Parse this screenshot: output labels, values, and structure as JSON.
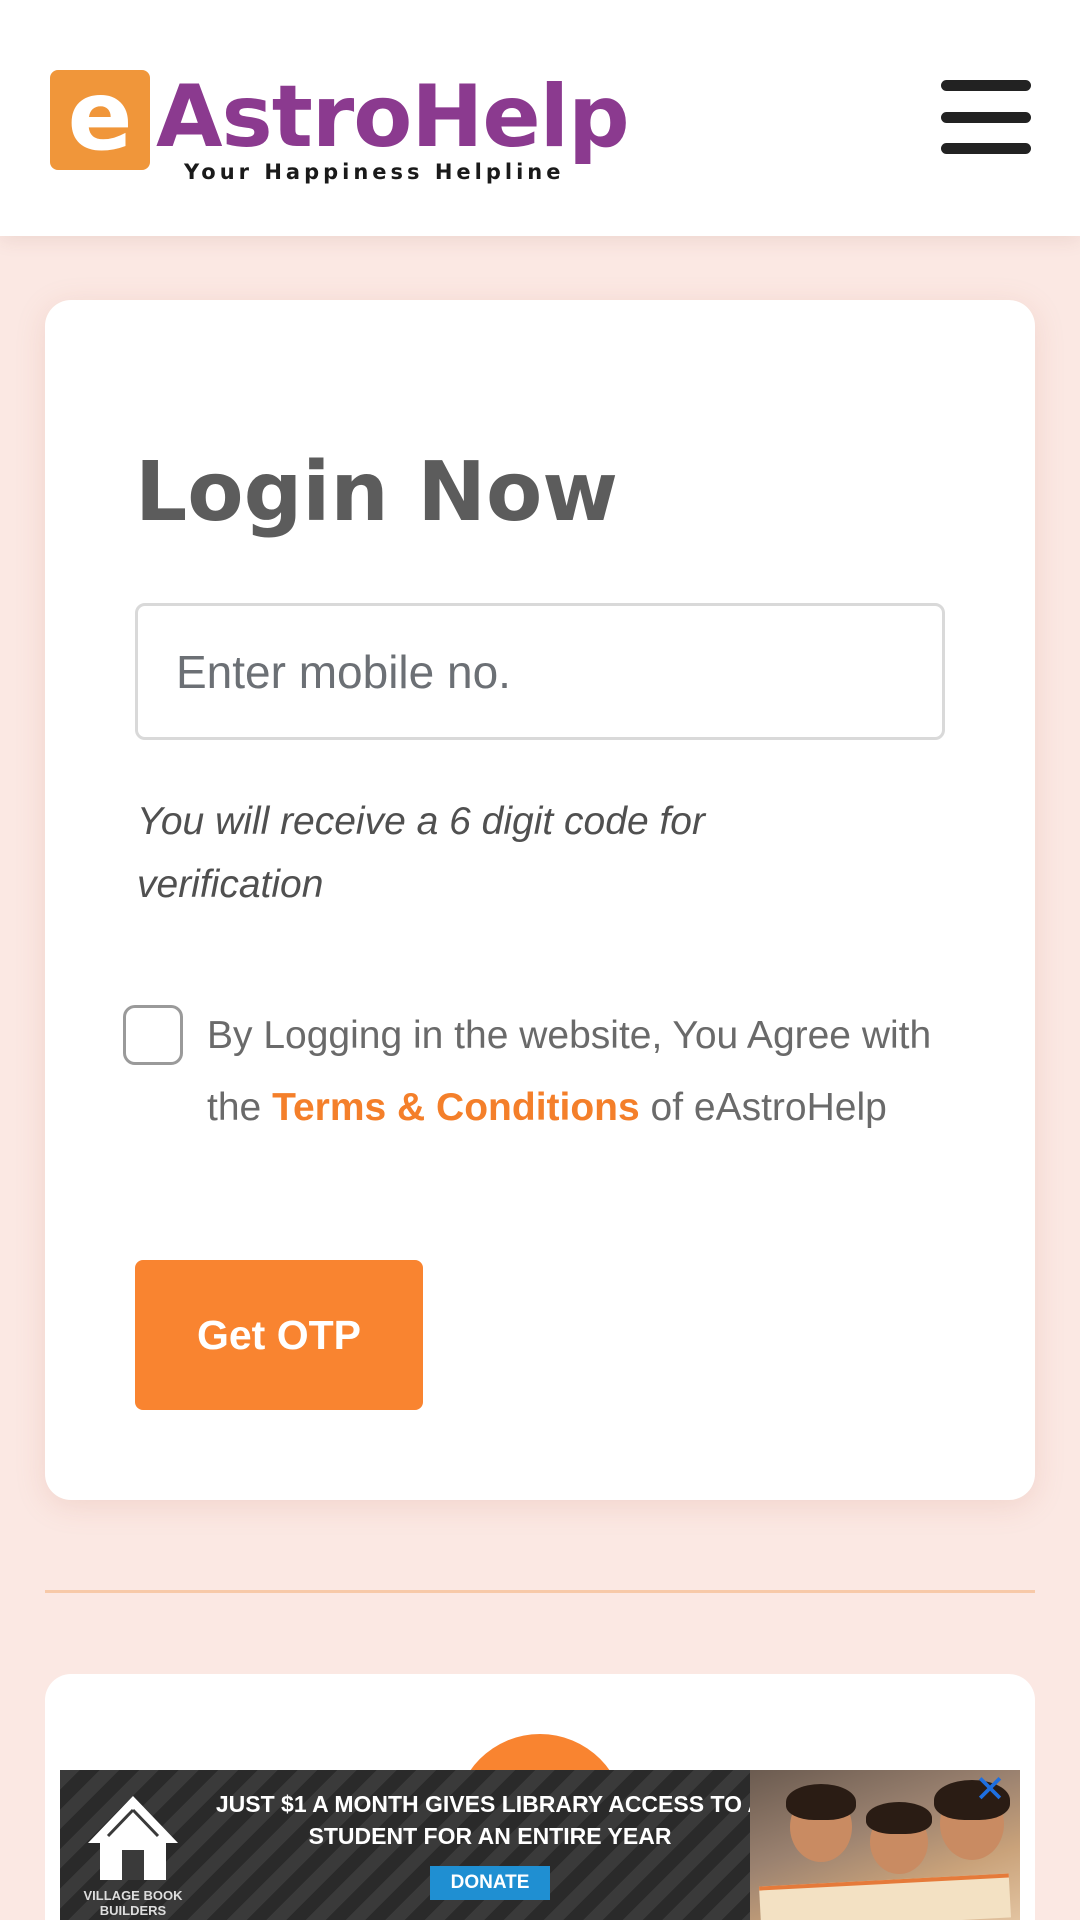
{
  "header": {
    "logo_letter": "e",
    "logo_name": "AstroHelp",
    "logo_tagline": "Your Happiness Helpline",
    "menu_icon": "hamburger-menu-icon"
  },
  "login": {
    "title": "Login Now",
    "mobile_placeholder": "Enter mobile no.",
    "hint": "You will receive a 6 digit code for verification",
    "agree_prefix": "By Logging in the website, You Agree with the ",
    "terms_link": "Terms & Conditions",
    "agree_suffix": " of eAstroHelp",
    "agree_checked": false,
    "otp_button": "Get OTP"
  },
  "ad": {
    "org": "VILLAGE BOOK BUILDERS",
    "headline": "JUST $1 A MONTH GIVES LIBRARY ACCESS TO A STUDENT FOR AN ENTIRE YEAR",
    "cta": "DONATE",
    "close_icon": "close-icon"
  },
  "colors": {
    "brand_orange": "#f98430",
    "brand_purple": "#8b3a8f",
    "page_bg": "#fbe8e3",
    "link": "#f47f2a"
  }
}
